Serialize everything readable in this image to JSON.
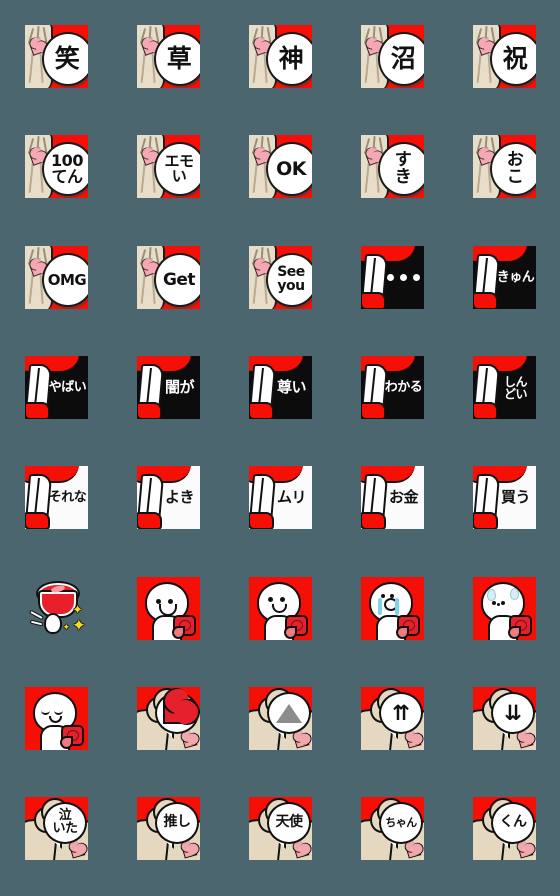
{
  "page": {
    "title": "Emoji sticker set preview grid",
    "background_color": "#4c6670",
    "columns": 5,
    "rows": 8,
    "tile_size_px": 63
  },
  "palette": {
    "background": "#4c6670",
    "red": "#f50f07",
    "black": "#0c0c0c",
    "white": "#ffffff",
    "hair_blonde": "#e4d8c0",
    "heart_pink": "#f2a6ad",
    "rose_red": "#e5222c",
    "tear_blue": "#7fd3ea",
    "gray_triangle": "#8c8c8c",
    "sparkle_yellow": "#f5d928"
  },
  "stickers": [
    {
      "row": 1,
      "col": 1,
      "style": "bubble-red",
      "label": "笑",
      "font_size": 25
    },
    {
      "row": 1,
      "col": 2,
      "style": "bubble-red",
      "label": "草",
      "font_size": 25
    },
    {
      "row": 1,
      "col": 3,
      "style": "bubble-red",
      "label": "神",
      "font_size": 25
    },
    {
      "row": 1,
      "col": 4,
      "style": "bubble-red",
      "label": "沼",
      "font_size": 25
    },
    {
      "row": 1,
      "col": 5,
      "style": "bubble-red",
      "label": "祝",
      "font_size": 25
    },
    {
      "row": 2,
      "col": 1,
      "style": "bubble-red",
      "label": "100\nてん",
      "font_size": 16
    },
    {
      "row": 2,
      "col": 2,
      "style": "bubble-red",
      "label": "エモ\nい",
      "font_size": 15
    },
    {
      "row": 2,
      "col": 3,
      "style": "bubble-red",
      "label": "OK",
      "font_size": 19
    },
    {
      "row": 2,
      "col": 4,
      "style": "bubble-red",
      "label": "す\nき",
      "font_size": 17
    },
    {
      "row": 2,
      "col": 5,
      "style": "bubble-red",
      "label": "お\nこ",
      "font_size": 17
    },
    {
      "row": 3,
      "col": 1,
      "style": "bubble-red",
      "label": "OMG",
      "font_size": 15
    },
    {
      "row": 3,
      "col": 2,
      "style": "bubble-red",
      "label": "Get",
      "font_size": 17
    },
    {
      "row": 3,
      "col": 3,
      "style": "bubble-red",
      "label": "See\nyou",
      "font_size": 14
    },
    {
      "row": 3,
      "col": 4,
      "style": "leg-black",
      "label": "",
      "font_size": 14,
      "icon": "three-dots"
    },
    {
      "row": 3,
      "col": 5,
      "style": "leg-black",
      "label": "きゅん",
      "font_size": 13
    },
    {
      "row": 4,
      "col": 1,
      "style": "leg-black",
      "label": "やばい",
      "font_size": 13
    },
    {
      "row": 4,
      "col": 2,
      "style": "leg-black",
      "label": "闇が",
      "font_size": 15
    },
    {
      "row": 4,
      "col": 3,
      "style": "leg-black",
      "label": "尊い",
      "font_size": 15
    },
    {
      "row": 4,
      "col": 4,
      "style": "leg-black",
      "label": "わかる",
      "font_size": 13
    },
    {
      "row": 4,
      "col": 5,
      "style": "leg-black",
      "label": "しん\nどい",
      "font_size": 12
    },
    {
      "row": 5,
      "col": 1,
      "style": "leg-white",
      "label": "それな",
      "font_size": 13
    },
    {
      "row": 5,
      "col": 2,
      "style": "leg-white",
      "label": "よき",
      "font_size": 15
    },
    {
      "row": 5,
      "col": 3,
      "style": "leg-white",
      "label": "ムリ",
      "font_size": 15
    },
    {
      "row": 5,
      "col": 4,
      "style": "leg-white",
      "label": "お金",
      "font_size": 15
    },
    {
      "row": 5,
      "col": 5,
      "style": "leg-white",
      "label": "買う",
      "font_size": 15
    },
    {
      "row": 6,
      "col": 1,
      "style": "gem",
      "label": "",
      "icon": "red-gem-sparkle"
    },
    {
      "row": 6,
      "col": 2,
      "style": "blob-red",
      "label": "",
      "face": "happy-open-smile"
    },
    {
      "row": 6,
      "col": 3,
      "style": "blob-red",
      "label": "",
      "face": "neutral-small-smile"
    },
    {
      "row": 6,
      "col": 4,
      "style": "blob-red",
      "label": "",
      "face": "crying-tears"
    },
    {
      "row": 6,
      "col": 5,
      "style": "blob-red",
      "label": "",
      "face": "sweating-nervous"
    },
    {
      "row": 7,
      "col": 1,
      "style": "blob-red",
      "label": "",
      "face": "sad-closed-eyes"
    },
    {
      "row": 7,
      "col": 2,
      "style": "hair-bubble",
      "label": "",
      "icon": "big-heart"
    },
    {
      "row": 7,
      "col": 3,
      "style": "hair-bubble",
      "label": "",
      "icon": "up-triangle"
    },
    {
      "row": 7,
      "col": 4,
      "style": "hair-bubble",
      "label": "",
      "icon": "double-up-arrow"
    },
    {
      "row": 7,
      "col": 5,
      "style": "hair-bubble",
      "label": "",
      "icon": "double-down-arrow"
    },
    {
      "row": 8,
      "col": 1,
      "style": "hair-bubble",
      "label": "泣\nいた",
      "font_size": 13
    },
    {
      "row": 8,
      "col": 2,
      "style": "hair-bubble",
      "label": "推し",
      "font_size": 14
    },
    {
      "row": 8,
      "col": 3,
      "style": "hair-bubble",
      "label": "天使",
      "font_size": 14
    },
    {
      "row": 8,
      "col": 4,
      "style": "hair-bubble",
      "label": "ちゃん",
      "font_size": 11
    },
    {
      "row": 8,
      "col": 5,
      "style": "hair-bubble",
      "label": "くん",
      "font_size": 14
    }
  ]
}
